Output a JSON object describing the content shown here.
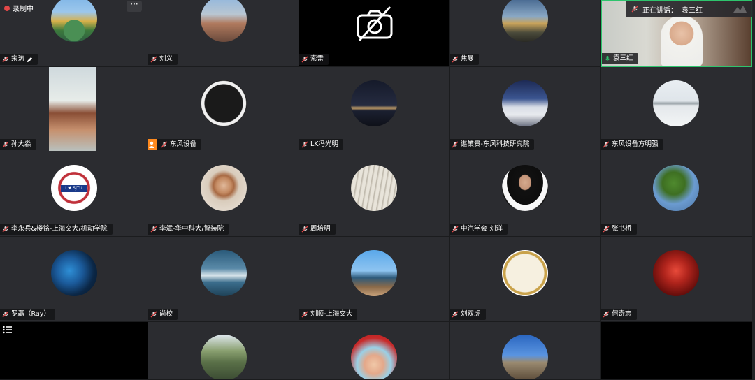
{
  "recording": {
    "label": "录制中"
  },
  "more_button": {
    "label": "···"
  },
  "active_speaker": {
    "label": "正在讲话：",
    "name": "袁三红"
  },
  "colors": {
    "speaking": "#2ec46d",
    "host": "#ff8a1e",
    "recording": "#e34848"
  },
  "participants": [
    {
      "name": "宋涛",
      "editing": true
    },
    {
      "name": "刘义"
    },
    {
      "name": "索雷",
      "video_off": true
    },
    {
      "name": "焦曼"
    },
    {
      "name": "袁三红",
      "speaking": true
    },
    {
      "name": "孙大淼"
    },
    {
      "name": "东风设备",
      "host": true
    },
    {
      "name": "LK冯光明"
    },
    {
      "name": "谌業贵-东风科技研究院"
    },
    {
      "name": "东风设备方明强"
    },
    {
      "name": "李永兵&楼铭-上海交大/机动学院"
    },
    {
      "name": "李斌-华中科大/智装院"
    },
    {
      "name": "周培明"
    },
    {
      "name": "中汽学会 刘洋"
    },
    {
      "name": "张书桥"
    },
    {
      "name": "罗磊（Ray）"
    },
    {
      "name": "尚校"
    },
    {
      "name": "刘顺-上海交大"
    },
    {
      "name": "刘双虎"
    },
    {
      "name": "何奇志"
    }
  ],
  "sjtu_logo_text": "I ♥ SJTU"
}
